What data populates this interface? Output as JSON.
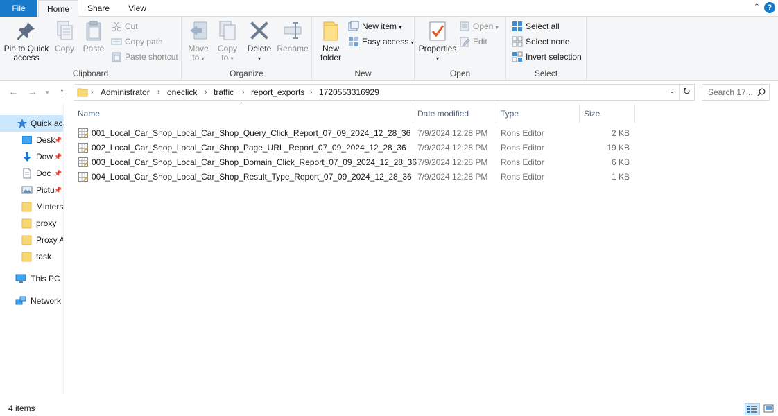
{
  "tabs": {
    "file": "File",
    "home": "Home",
    "share": "Share",
    "view": "View"
  },
  "ribbon": {
    "clipboard": {
      "label": "Clipboard",
      "pin_line1": "Pin to Quick",
      "pin_line2": "access",
      "copy": "Copy",
      "paste": "Paste",
      "cut": "Cut",
      "copy_path": "Copy path",
      "paste_shortcut": "Paste shortcut"
    },
    "organize": {
      "label": "Organize",
      "move_line1": "Move",
      "move_line2": "to",
      "copy_line1": "Copy",
      "copy_line2": "to",
      "delete": "Delete",
      "rename": "Rename"
    },
    "new": {
      "label": "New",
      "folder_line1": "New",
      "folder_line2": "folder",
      "new_item": "New item",
      "easy_access": "Easy access"
    },
    "open": {
      "label": "Open",
      "properties": "Properties",
      "open": "Open",
      "edit": "Edit"
    },
    "select": {
      "label": "Select",
      "select_all": "Select all",
      "select_none": "Select none",
      "invert": "Invert selection"
    }
  },
  "address": {
    "crumbs": [
      "Administrator",
      "oneclick",
      "traffic",
      "report_exports",
      "1720553316929"
    ],
    "search_placeholder": "Search 17..."
  },
  "nav": {
    "quick_access": "Quick ac",
    "items": [
      {
        "label": "Desk",
        "pinned": true
      },
      {
        "label": "Dow",
        "pinned": true
      },
      {
        "label": "Doc",
        "pinned": true
      },
      {
        "label": "Pictu",
        "pinned": true
      },
      {
        "label": "Minters",
        "pinned": false
      },
      {
        "label": "proxy",
        "pinned": false
      },
      {
        "label": "Proxy A",
        "pinned": false
      },
      {
        "label": "task",
        "pinned": false
      }
    ],
    "this_pc": "This PC",
    "network": "Network"
  },
  "columns": {
    "name": "Name",
    "date": "Date modified",
    "type": "Type",
    "size": "Size"
  },
  "files": [
    {
      "name": "001_Local_Car_Shop_Local_Car_Shop_Query_Click_Report_07_09_2024_12_28_36",
      "date": "7/9/2024 12:28 PM",
      "type": "Rons Editor",
      "size": "2 KB"
    },
    {
      "name": "002_Local_Car_Shop_Local_Car_Shop_Page_URL_Report_07_09_2024_12_28_36",
      "date": "7/9/2024 12:28 PM",
      "type": "Rons Editor",
      "size": "19 KB"
    },
    {
      "name": "003_Local_Car_Shop_Local_Car_Shop_Domain_Click_Report_07_09_2024_12_28_36",
      "date": "7/9/2024 12:28 PM",
      "type": "Rons Editor",
      "size": "6 KB"
    },
    {
      "name": "004_Local_Car_Shop_Local_Car_Shop_Result_Type_Report_07_09_2024_12_28_36",
      "date": "7/9/2024 12:28 PM",
      "type": "Rons Editor",
      "size": "1 KB"
    }
  ],
  "status": {
    "count": "4 items"
  },
  "colors": {
    "accent": "#1979ca",
    "selection": "#cce8ff",
    "folder": "#f8d775"
  }
}
